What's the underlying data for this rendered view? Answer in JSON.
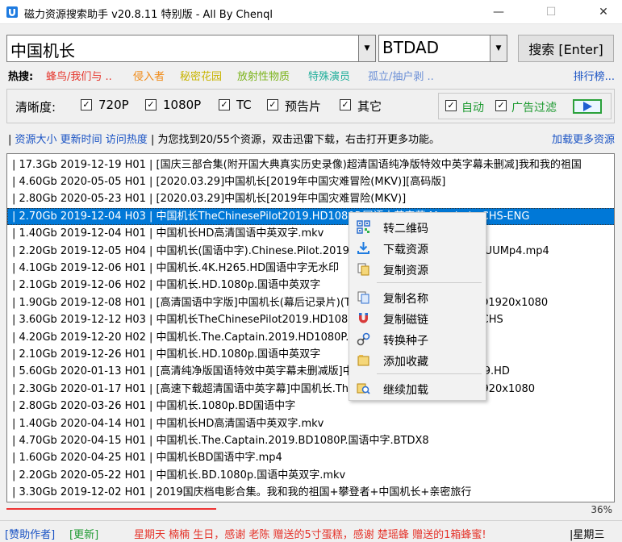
{
  "window": {
    "title": "磁力资源搜索助手 v20.8.11 特别版 - All By Chenql",
    "min_label": "—",
    "max_label": "☐",
    "close_label": "✕"
  },
  "search": {
    "query": "中国机长",
    "engine": "BTDAD",
    "button_label": "搜索 [Enter]",
    "dropdown_arrow": "▼"
  },
  "hot": {
    "label": "热搜:",
    "items": [
      {
        "text": "蜂鸟/我们与 ..",
        "color": "#e5332a"
      },
      {
        "text": "侵入者",
        "color": "#f08a16"
      },
      {
        "text": "秘密花园",
        "color": "#c8b400"
      },
      {
        "text": "放射性物质",
        "color": "#7bb31b"
      },
      {
        "text": "特殊演员",
        "color": "#1fae9a"
      },
      {
        "text": "孤立/抽户剥 ..",
        "color": "#6b8fd6"
      }
    ],
    "more": "排行榜..."
  },
  "filters": {
    "label": "清晰度:",
    "check_mark": "✓",
    "options": [
      "720P",
      "1080P",
      "TC",
      "预告片",
      "其它"
    ],
    "auto_label": "自动",
    "ad_filter_label": "广告过滤"
  },
  "info": {
    "prefix": "| ",
    "sort_size": "资源大小",
    "sort_time": "更新时间",
    "sort_hot": "访问热度",
    "message": " | 为您找到20/55个资源，双击迅雷下载，右击打开更多功能。",
    "load_more": "加载更多资源"
  },
  "results": [
    "| 17.3Gb 2019-12-19 H01 | [国庆三部合集(附开国大典真实历史录像)超清国语纯净版特效中英字幕未删减]我和我的祖国",
    "| 4.60Gb 2020-05-05 H01 | [2020.03.29]中国机长[2019年中国灾难冒险(MKV)][高码版]",
    "| 2.80Gb 2020-05-23 H01 | [2020.03.29]中国机长[2019年中国灾难冒险(MKV)]",
    "| 2.70Gb 2019-12-04 H03 | 中国机长TheChinesePilot2019.HD1080P.国语中英字幕.Mandarin.CHS-ENG",
    "| 1.40Gb 2019-12-04 H01 | 中国机长HD高清国语中英双字.mkv",
    "| 2.20Gb 2019-12-05 H04 | 中国机长(国语中字).Chinese.Pilot.2019.HD1080P.X264.AAC.CHS-UUMp4.mp4",
    "| 4.10Gb 2019-12-06 H01 | 中国机长.4K.H265.HD国语中字无水印",
    "| 2.10Gb 2019-12-06 H02 | 中国机长.HD.1080p.国语中英双字",
    "| 1.90Gb 2019-12-08 H01 | [高清国语中字版]中国机长(幕后记录片)(The.Chinese.Pilot).2019.HD1920x1080",
    "| 3.60Gb 2019-12-12 H03 | 中国机长TheChinesePilot2019.HD1080P.国语中英字幕.Mandarin.CHS",
    "| 4.20Gb 2019-12-20 H02 | 中国机长.The.Captain.2019.HD1080P.国语中字无水印",
    "| 2.10Gb 2019-12-26 H01 | 中国机长.HD.1080p.国语中英双字",
    "| 5.60Gb 2020-01-13 H01 | [高清纯净版国语特效中英字幕未删减版]中国机长(Chinese.Pilot).2019.HD",
    "| 2.30Gb 2020-01-17 H01 | [高速下载超清国语中英字幕]中国机长.The.Chinese.Pilot.2019.HD1920x1080",
    "| 2.80Gb 2020-03-26 H01 | 中国机长.1080p.BD国语中字",
    "| 1.40Gb 2020-04-14 H01 | 中国机长HD高清国语中英双字.mkv",
    "| 4.70Gb 2020-04-15 H01 | 中国机长.The.Captain.2019.BD1080P.国语中字.BTDX8",
    "| 1.60Gb 2020-04-25 H01 | 中国机长BD国语中字.mp4",
    "| 2.20Gb 2020-05-22 H01 | 中国机长.BD.1080p.国语中英双字.mkv",
    "| 3.30Gb 2019-12-02 H01 | 2019国庆档电影合集。我和我的祖国+攀登者+中国机长+亲密旅行"
  ],
  "selected_index": 3,
  "progress": {
    "fraction": 0.345,
    "label": "36%"
  },
  "context_menu": {
    "items": [
      {
        "label": "转二维码",
        "icon": "qr-code-icon"
      },
      {
        "label": "下载资源",
        "icon": "download-icon"
      },
      {
        "label": "复制资源",
        "icon": "copy-resource-icon"
      },
      {
        "label": "复制名称",
        "icon": "copy-name-icon"
      },
      {
        "label": "复制磁链",
        "icon": "magnet-icon"
      },
      {
        "label": "转换种子",
        "icon": "convert-torrent-icon"
      },
      {
        "label": "添加收藏",
        "icon": "favorite-icon"
      },
      {
        "label": "继续加载",
        "icon": "load-more-icon"
      }
    ]
  },
  "status": {
    "donate": "[赞助作者]",
    "update": "[更新]",
    "message": "星期天 楠楠 生日，感谢 老陈 赠送的5寸蛋糕，感谢 楚瑶蜂 赠送的1箱蜂蜜!",
    "weekday": "|星期三"
  }
}
